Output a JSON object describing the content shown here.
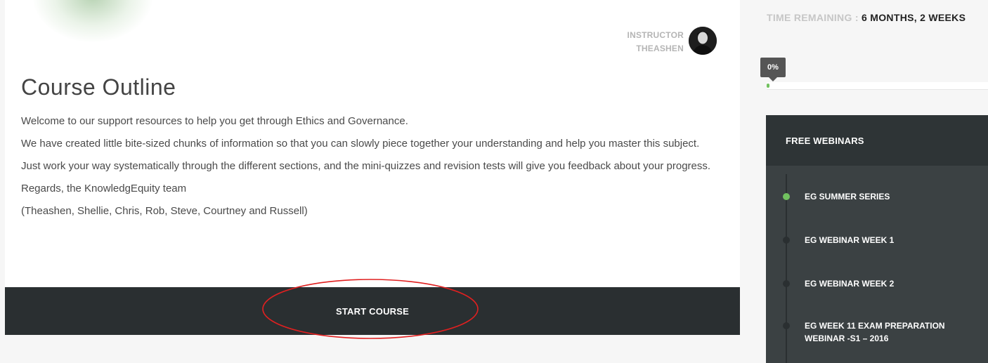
{
  "instructor": {
    "label": "INSTRUCTOR",
    "name": "THEASHEN"
  },
  "course": {
    "title": "Course Outline",
    "paragraphs": [
      "Welcome to our support resources to help you get through Ethics and Governance.",
      "We have created little bite-sized chunks of information so that you can slowly piece together your understanding and help you master this subject.",
      "Just work your way systematically through the different sections, and the mini-quizzes and revision tests will give you feedback about your progress.",
      "Regards, the KnowledgEquity team",
      "(Theashen, Shellie, Chris, Rob, Steve, Courtney and Russell)"
    ],
    "start_label": "START COURSE"
  },
  "sidebar": {
    "time_label": "TIME REMAINING :",
    "time_value": "6 MONTHS, 2 WEEKS",
    "progress_label": "0%",
    "progress_fraction": 0,
    "webinars": {
      "title": "FREE WEBINARS",
      "items": [
        {
          "label": "EG SUMMER SERIES",
          "active": true
        },
        {
          "label": "EG WEBINAR WEEK 1",
          "active": false
        },
        {
          "label": "EG WEBINAR WEEK 2",
          "active": false
        },
        {
          "label": "EG WEEK 11 EXAM PREPARATION WEBINAR -S1 – 2016",
          "active": false
        }
      ]
    }
  },
  "colors": {
    "dark_bar": "#2a2f31",
    "panel": "#3b4143",
    "accent_green": "#71c15f",
    "annotation_red": "#e02020"
  }
}
